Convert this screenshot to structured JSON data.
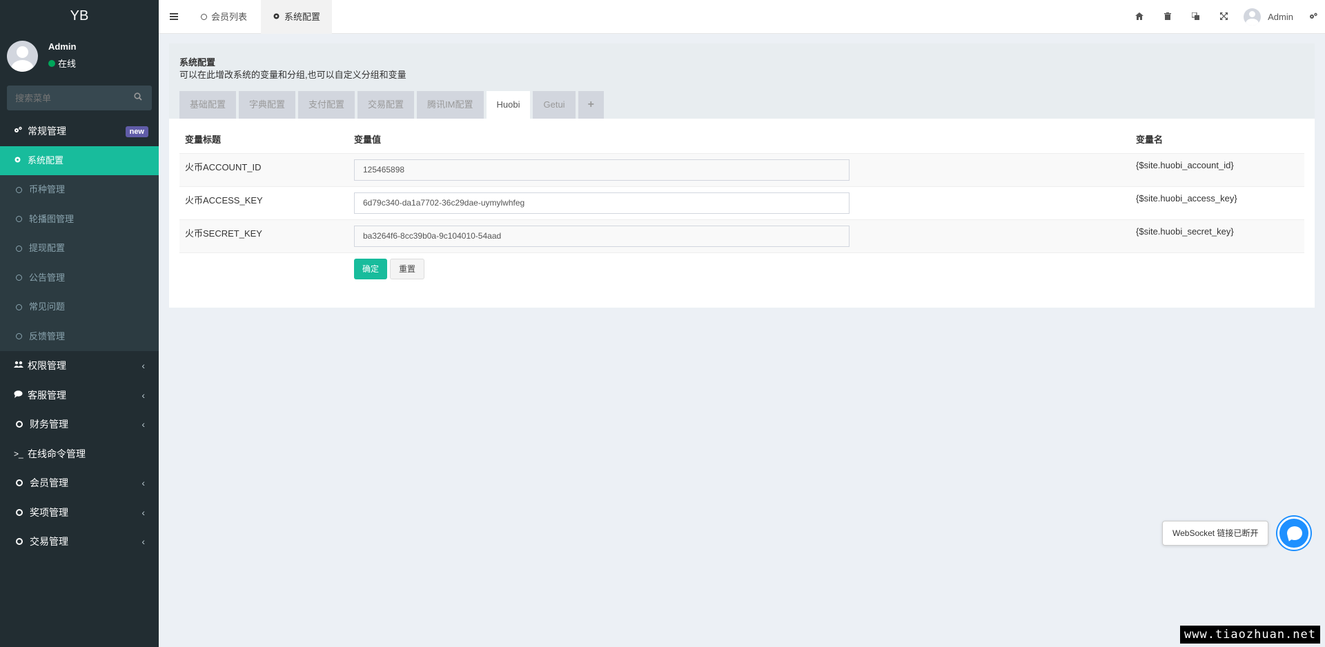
{
  "sidebar": {
    "logo": "YB",
    "user_name": "Admin",
    "user_status": "在线",
    "search_placeholder": "搜索菜单",
    "groups": [
      {
        "label": "常规管理",
        "badge": "new",
        "icon": "cogs-icon"
      },
      {
        "label": "权限管理",
        "icon": "users-icon"
      },
      {
        "label": "客服管理",
        "icon": "comment-icon"
      },
      {
        "label": "财务管理",
        "icon": "circle-icon"
      },
      {
        "label": "在线命令管理",
        "icon": "terminal-icon"
      },
      {
        "label": "会员管理",
        "icon": "circle-icon"
      },
      {
        "label": "奖项管理",
        "icon": "circle-icon"
      },
      {
        "label": "交易管理",
        "icon": "circle-icon"
      }
    ],
    "sub_items": [
      "系统配置",
      "币种管理",
      "轮播图管理",
      "提现配置",
      "公告管理",
      "常见问题",
      "反馈管理"
    ]
  },
  "header": {
    "tabs": [
      "会员列表",
      "系统配置"
    ],
    "user": "Admin"
  },
  "panel": {
    "title": "系统配置",
    "description": "可以在此增改系统的变量和分组,也可以自定义分组和变量",
    "config_tabs": [
      "基础配置",
      "字典配置",
      "支付配置",
      "交易配置",
      "腾讯IM配置",
      "Huobi",
      "Getui",
      "+"
    ],
    "active_tab": "Huobi",
    "columns": [
      "变量标题",
      "变量值",
      "变量名"
    ],
    "rows": [
      {
        "title": "火币ACCOUNT_ID",
        "value": "125465898",
        "name": "{$site.huobi_account_id}"
      },
      {
        "title": "火币ACCESS_KEY",
        "value": "6d79c340-da1a7702-36c29dae-uymylwhfeg",
        "name": "{$site.huobi_access_key}"
      },
      {
        "title": "火币SECRET_KEY",
        "value": "ba3264f6-8cc39b0a-9c104010-54aad",
        "name": "{$site.huobi_secret_key}"
      }
    ],
    "ok_label": "确定",
    "reset_label": "重置"
  },
  "websocket_tip": "WebSocket 链接已断开",
  "watermark": "www.tiaozhuan.net",
  "colors": {
    "sidebar": "#222d32",
    "accent": "#18bc9c",
    "badge": "#605ca8"
  }
}
